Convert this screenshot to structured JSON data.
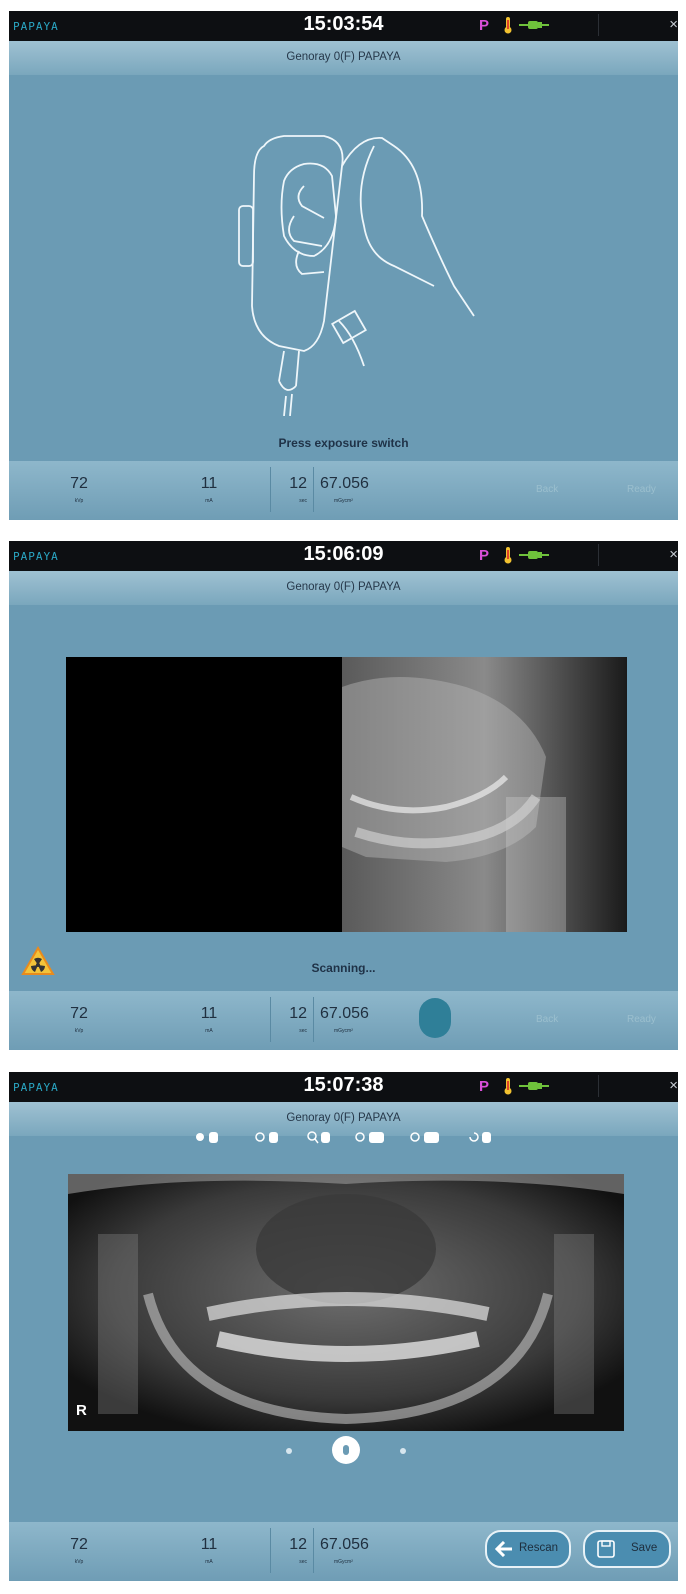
{
  "screens": [
    {
      "brand": "PAPAYA",
      "time": "15:03:54",
      "indicator": "P",
      "title": "Genoray  0(F)  PAPAYA",
      "status": "Press exposure switch",
      "params": {
        "kvp": "72",
        "kvp_unit": "kVp",
        "ma": "11",
        "ma_unit": "mA",
        "sec": "12",
        "sec_unit": "sec",
        "dose": "67.056",
        "dose_unit": "mGycm²"
      },
      "back_label": "Back",
      "ready_label": "Ready",
      "close": "×"
    },
    {
      "brand": "PAPAYA",
      "time": "15:06:09",
      "indicator": "P",
      "title": "Genoray  0(F)  PAPAYA",
      "status": "Scanning...",
      "params": {
        "kvp": "72",
        "kvp_unit": "kVp",
        "ma": "11",
        "ma_unit": "mA",
        "sec": "12",
        "sec_unit": "sec",
        "dose": "67.056",
        "dose_unit": "mGycm²"
      },
      "back_label": "Back",
      "ready_label": "Ready",
      "close": "×",
      "warning_icon": "radiation-warning-icon"
    },
    {
      "brand": "PAPAYA",
      "time": "15:07:38",
      "indicator": "P",
      "title": "Genoray  0(F)  PAPAYA",
      "params": {
        "kvp": "72",
        "kvp_unit": "kVp",
        "ma": "11",
        "ma_unit": "mA",
        "sec": "12",
        "sec_unit": "sec",
        "dose": "67.056",
        "dose_unit": "mGycm²"
      },
      "image_marker": "R",
      "rescan_label": "Rescan",
      "save_label": "Save",
      "close": "×",
      "toolbar_icons": [
        "pan-icon",
        "brightness-icon",
        "zoom-icon",
        "flip-icon",
        "invert-icon",
        "rotate-icon"
      ]
    }
  ],
  "colors": {
    "screen_bg": "#6b9bb4",
    "topbar": "#0d0f12",
    "indicator": "#d94fd9",
    "brand": "#2aa7c4"
  }
}
